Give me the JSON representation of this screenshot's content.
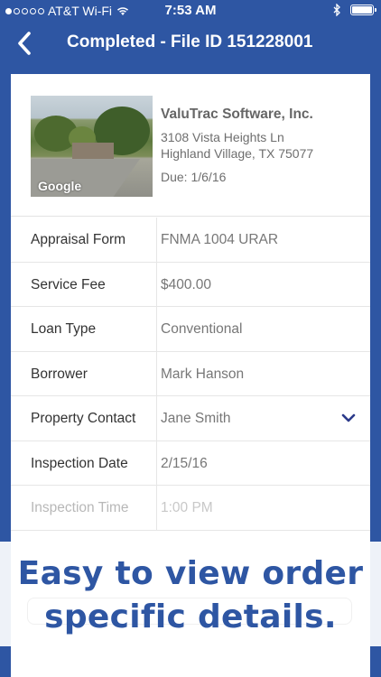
{
  "status_bar": {
    "carrier": "AT&T Wi-Fi",
    "time": "7:53 AM"
  },
  "nav": {
    "title": "Completed - File ID 151228001"
  },
  "order": {
    "photo_label": "Google",
    "company": "ValuTrac Software, Inc.",
    "address_line1": "3108 Vista Heights Ln",
    "address_line2": "Highland Village, TX 75077",
    "due": "Due: 1/6/16"
  },
  "details": [
    {
      "label": "Appraisal Form",
      "value": "FNMA 1004 URAR"
    },
    {
      "label": "Service Fee",
      "value": "$400.00"
    },
    {
      "label": "Loan Type",
      "value": "Conventional"
    },
    {
      "label": "Borrower",
      "value": "Mark Hanson"
    },
    {
      "label": "Property Contact",
      "value": "Jane Smith"
    },
    {
      "label": "Inspection Date",
      "value": "2/15/16"
    },
    {
      "label": "Inspection Time",
      "value": "1:00 PM"
    }
  ],
  "promo": {
    "line1": "Easy to view order",
    "line2": "specific details."
  },
  "colors": {
    "brand_blue": "#2e56a3",
    "chevron": "#2b3a8a"
  },
  "icons": {
    "back": "chevron-left-icon",
    "expand": "chevron-down-icon",
    "wifi": "wifi-icon",
    "bluetooth": "bluetooth-icon",
    "battery": "battery-icon"
  }
}
